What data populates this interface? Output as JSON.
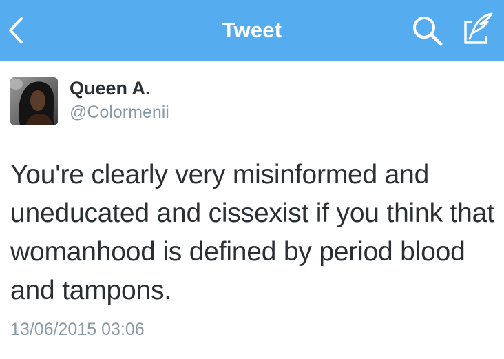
{
  "navbar": {
    "title": "Tweet",
    "background": "#55acee",
    "back_icon": "chevron-left-icon",
    "search_icon": "search-icon",
    "compose_icon": "compose-tweet-icon"
  },
  "tweet": {
    "author": {
      "display_name": "Queen A.",
      "handle": "@Colormenii",
      "avatar": "profile-photo"
    },
    "text": "You're clearly very misinformed and uneducated and cissexist if you think that womanhood is defined by period blood and tampons.",
    "timestamp": "13/06/2015 03:06"
  },
  "colors": {
    "text_primary": "#292f33",
    "text_secondary": "#8899a6"
  }
}
